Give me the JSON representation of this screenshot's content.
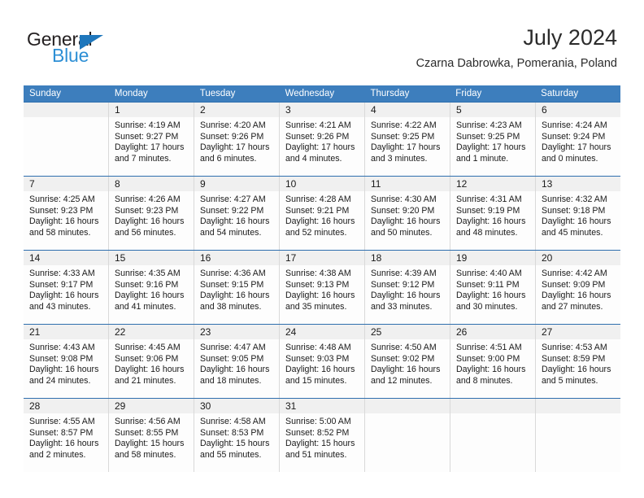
{
  "logo": {
    "word_dark": "General",
    "word_blue": "Blue",
    "triangle_color": "#1f77bc",
    "blue_color": "#2d8fd5"
  },
  "header": {
    "title": "July 2024",
    "subtitle": "Czarna Dabrowka, Pomerania, Poland"
  },
  "theme": {
    "header_bg": "#3d7ebd",
    "week_divider": "#2f6fae",
    "daynum_bg": "#f0f0f0",
    "cell_border": "#d9d9d9"
  },
  "calendar": {
    "day_headers": [
      "Sunday",
      "Monday",
      "Tuesday",
      "Wednesday",
      "Thursday",
      "Friday",
      "Saturday"
    ],
    "weeks": [
      {
        "numbers": [
          "",
          "1",
          "2",
          "3",
          "4",
          "5",
          "6"
        ],
        "cells": [
          {
            "l1": "",
            "l2": "",
            "l3": "",
            "l4": ""
          },
          {
            "l1": "Sunrise: 4:19 AM",
            "l2": "Sunset: 9:27 PM",
            "l3": "Daylight: 17 hours",
            "l4": "and 7 minutes."
          },
          {
            "l1": "Sunrise: 4:20 AM",
            "l2": "Sunset: 9:26 PM",
            "l3": "Daylight: 17 hours",
            "l4": "and 6 minutes."
          },
          {
            "l1": "Sunrise: 4:21 AM",
            "l2": "Sunset: 9:26 PM",
            "l3": "Daylight: 17 hours",
            "l4": "and 4 minutes."
          },
          {
            "l1": "Sunrise: 4:22 AM",
            "l2": "Sunset: 9:25 PM",
            "l3": "Daylight: 17 hours",
            "l4": "and 3 minutes."
          },
          {
            "l1": "Sunrise: 4:23 AM",
            "l2": "Sunset: 9:25 PM",
            "l3": "Daylight: 17 hours",
            "l4": "and 1 minute."
          },
          {
            "l1": "Sunrise: 4:24 AM",
            "l2": "Sunset: 9:24 PM",
            "l3": "Daylight: 17 hours",
            "l4": "and 0 minutes."
          }
        ]
      },
      {
        "numbers": [
          "7",
          "8",
          "9",
          "10",
          "11",
          "12",
          "13"
        ],
        "cells": [
          {
            "l1": "Sunrise: 4:25 AM",
            "l2": "Sunset: 9:23 PM",
            "l3": "Daylight: 16 hours",
            "l4": "and 58 minutes."
          },
          {
            "l1": "Sunrise: 4:26 AM",
            "l2": "Sunset: 9:23 PM",
            "l3": "Daylight: 16 hours",
            "l4": "and 56 minutes."
          },
          {
            "l1": "Sunrise: 4:27 AM",
            "l2": "Sunset: 9:22 PM",
            "l3": "Daylight: 16 hours",
            "l4": "and 54 minutes."
          },
          {
            "l1": "Sunrise: 4:28 AM",
            "l2": "Sunset: 9:21 PM",
            "l3": "Daylight: 16 hours",
            "l4": "and 52 minutes."
          },
          {
            "l1": "Sunrise: 4:30 AM",
            "l2": "Sunset: 9:20 PM",
            "l3": "Daylight: 16 hours",
            "l4": "and 50 minutes."
          },
          {
            "l1": "Sunrise: 4:31 AM",
            "l2": "Sunset: 9:19 PM",
            "l3": "Daylight: 16 hours",
            "l4": "and 48 minutes."
          },
          {
            "l1": "Sunrise: 4:32 AM",
            "l2": "Sunset: 9:18 PM",
            "l3": "Daylight: 16 hours",
            "l4": "and 45 minutes."
          }
        ]
      },
      {
        "numbers": [
          "14",
          "15",
          "16",
          "17",
          "18",
          "19",
          "20"
        ],
        "cells": [
          {
            "l1": "Sunrise: 4:33 AM",
            "l2": "Sunset: 9:17 PM",
            "l3": "Daylight: 16 hours",
            "l4": "and 43 minutes."
          },
          {
            "l1": "Sunrise: 4:35 AM",
            "l2": "Sunset: 9:16 PM",
            "l3": "Daylight: 16 hours",
            "l4": "and 41 minutes."
          },
          {
            "l1": "Sunrise: 4:36 AM",
            "l2": "Sunset: 9:15 PM",
            "l3": "Daylight: 16 hours",
            "l4": "and 38 minutes."
          },
          {
            "l1": "Sunrise: 4:38 AM",
            "l2": "Sunset: 9:13 PM",
            "l3": "Daylight: 16 hours",
            "l4": "and 35 minutes."
          },
          {
            "l1": "Sunrise: 4:39 AM",
            "l2": "Sunset: 9:12 PM",
            "l3": "Daylight: 16 hours",
            "l4": "and 33 minutes."
          },
          {
            "l1": "Sunrise: 4:40 AM",
            "l2": "Sunset: 9:11 PM",
            "l3": "Daylight: 16 hours",
            "l4": "and 30 minutes."
          },
          {
            "l1": "Sunrise: 4:42 AM",
            "l2": "Sunset: 9:09 PM",
            "l3": "Daylight: 16 hours",
            "l4": "and 27 minutes."
          }
        ]
      },
      {
        "numbers": [
          "21",
          "22",
          "23",
          "24",
          "25",
          "26",
          "27"
        ],
        "cells": [
          {
            "l1": "Sunrise: 4:43 AM",
            "l2": "Sunset: 9:08 PM",
            "l3": "Daylight: 16 hours",
            "l4": "and 24 minutes."
          },
          {
            "l1": "Sunrise: 4:45 AM",
            "l2": "Sunset: 9:06 PM",
            "l3": "Daylight: 16 hours",
            "l4": "and 21 minutes."
          },
          {
            "l1": "Sunrise: 4:47 AM",
            "l2": "Sunset: 9:05 PM",
            "l3": "Daylight: 16 hours",
            "l4": "and 18 minutes."
          },
          {
            "l1": "Sunrise: 4:48 AM",
            "l2": "Sunset: 9:03 PM",
            "l3": "Daylight: 16 hours",
            "l4": "and 15 minutes."
          },
          {
            "l1": "Sunrise: 4:50 AM",
            "l2": "Sunset: 9:02 PM",
            "l3": "Daylight: 16 hours",
            "l4": "and 12 minutes."
          },
          {
            "l1": "Sunrise: 4:51 AM",
            "l2": "Sunset: 9:00 PM",
            "l3": "Daylight: 16 hours",
            "l4": "and 8 minutes."
          },
          {
            "l1": "Sunrise: 4:53 AM",
            "l2": "Sunset: 8:59 PM",
            "l3": "Daylight: 16 hours",
            "l4": "and 5 minutes."
          }
        ]
      },
      {
        "numbers": [
          "28",
          "29",
          "30",
          "31",
          "",
          "",
          ""
        ],
        "cells": [
          {
            "l1": "Sunrise: 4:55 AM",
            "l2": "Sunset: 8:57 PM",
            "l3": "Daylight: 16 hours",
            "l4": "and 2 minutes."
          },
          {
            "l1": "Sunrise: 4:56 AM",
            "l2": "Sunset: 8:55 PM",
            "l3": "Daylight: 15 hours",
            "l4": "and 58 minutes."
          },
          {
            "l1": "Sunrise: 4:58 AM",
            "l2": "Sunset: 8:53 PM",
            "l3": "Daylight: 15 hours",
            "l4": "and 55 minutes."
          },
          {
            "l1": "Sunrise: 5:00 AM",
            "l2": "Sunset: 8:52 PM",
            "l3": "Daylight: 15 hours",
            "l4": "and 51 minutes."
          },
          {
            "l1": "",
            "l2": "",
            "l3": "",
            "l4": ""
          },
          {
            "l1": "",
            "l2": "",
            "l3": "",
            "l4": ""
          },
          {
            "l1": "",
            "l2": "",
            "l3": "",
            "l4": ""
          }
        ]
      }
    ]
  }
}
